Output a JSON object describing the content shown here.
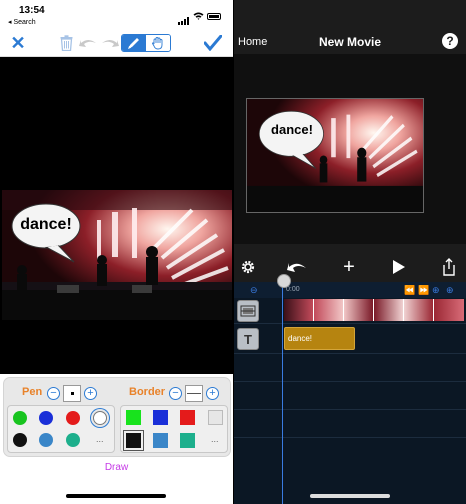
{
  "left_screen": {
    "status": {
      "time": "13:54",
      "back_label": "◂ Search"
    },
    "toolbar": {
      "close_icon": "close-icon",
      "trash_icon": "trash-icon",
      "undo_icon": "undo-icon",
      "redo_icon": "redo-icon",
      "pen_mode_icon": "pen-icon",
      "hand_mode_icon": "hand-icon",
      "done_icon": "checkmark-icon"
    },
    "overlay": {
      "bubble_text": "dance!"
    },
    "draw_panel": {
      "pen_label": "Pen",
      "border_label": "Border",
      "pen_colors": [
        "#18c41f",
        "#1a2fd8",
        "#e41b1b",
        "#ffffff",
        "#111111",
        "#3a86c8",
        "#1daf8c"
      ],
      "border_colors": [
        "#18e31d",
        "#1a2fd8",
        "#e41b1b",
        "#e6e6e6",
        "#111111",
        "#3a86c8",
        "#1daf8c"
      ],
      "more_label": "...",
      "mode_label": "Draw"
    }
  },
  "right_screen": {
    "nav": {
      "home_label": "Home",
      "title": "New Movie",
      "help_label": "?"
    },
    "preview": {
      "bubble_text": "dance!"
    },
    "controls": [
      "settings-gear-icon",
      "undo-icon",
      "add-icon",
      "play-icon",
      "share-icon"
    ],
    "timeline": {
      "ruler_time": "0:00",
      "text_clip_label": "dance!"
    }
  }
}
